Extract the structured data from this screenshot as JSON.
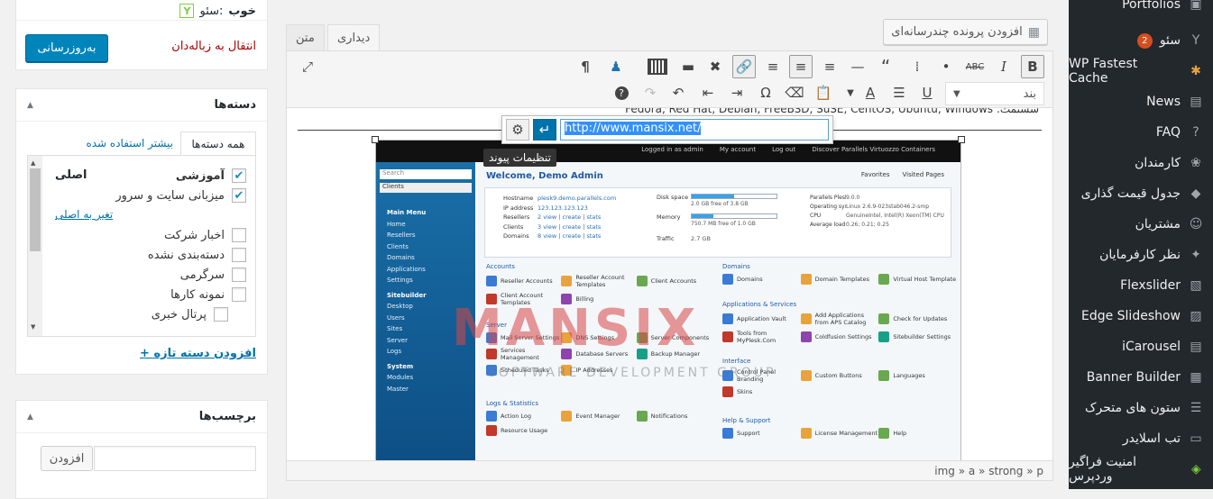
{
  "admin_menu": {
    "items": [
      {
        "label": "Portfolios",
        "icon": "portfolio-icon"
      },
      {
        "label": "سئو",
        "icon": "yoast-icon",
        "badge": "2"
      },
      {
        "label": "WP Fastest Cache",
        "icon": "cheetah-icon"
      },
      {
        "label": "News",
        "icon": "news-icon"
      },
      {
        "label": "FAQ",
        "icon": "question-icon"
      },
      {
        "label": "کارمندان",
        "icon": "paw-icon"
      },
      {
        "label": "جدول قیمت گذاری",
        "icon": "tag-icon"
      },
      {
        "label": "مشتریان",
        "icon": "users-icon"
      },
      {
        "label": "نظر کارفرمایان",
        "icon": "testimonial-icon"
      },
      {
        "label": "Flexslider",
        "icon": "slides-icon"
      },
      {
        "label": "Edge Slideshow",
        "icon": "slideshow-icon"
      },
      {
        "label": "iCarousel",
        "icon": "carousel-icon"
      },
      {
        "label": "Banner Builder",
        "icon": "banner-icon"
      },
      {
        "label": "ستون های متحرک",
        "icon": "columns-icon"
      },
      {
        "label": "تب اسلایدر",
        "icon": "tab-slider-icon"
      },
      {
        "label": "امنیت فراگیر وردپرس",
        "icon": "shield-icon"
      }
    ]
  },
  "editor": {
    "tabs": {
      "visual": "دیداری",
      "text": "متن"
    },
    "add_media": "افزودن پرونده چندرسانه‌ای",
    "format_select": "بند",
    "status_path": "img » a » strong » p",
    "content_line": "Fedora, Red Hat, Debian, FreeBSD, SuSE, CentOS, Ubuntu, Windows :ششتمت",
    "link_popup": {
      "url": "http://www.mansix.net/",
      "tooltip": "تنظیمات پیوند"
    }
  },
  "publish_box": {
    "seo_label": "سئو:",
    "seo_value": "خوب",
    "trash_link": "انتقال به زباله‌دان",
    "update_button": "به‌روزرسانی"
  },
  "categories_box": {
    "title": "دسته‌ها",
    "tab_all": "همه دسته‌ها",
    "tab_popular": "بیشتر استفاده شده",
    "items": [
      {
        "label": "آموزشی",
        "checked": true,
        "primary": "اصلی",
        "bold": true
      },
      {
        "label": "میزبانی سایت و سرور",
        "checked": true,
        "make_primary": "تغیر به اصلی"
      },
      {
        "label": "اخبار شرکت",
        "checked": false
      },
      {
        "label": "دسته‌بندی نشده",
        "checked": false
      },
      {
        "label": "سرگرمی",
        "checked": false
      },
      {
        "label": "نمونه کارها",
        "checked": false
      },
      {
        "label": "پرتال خبری",
        "checked": false
      }
    ],
    "add_new": "+ افزودن دسته تازه"
  },
  "tags_box": {
    "title": "برچسب‌ها",
    "add_button": "افزودن"
  },
  "embedded_screenshot": {
    "topbar": [
      "Logged in as admin",
      "My account",
      "Log out",
      "Discover Parallels Virtuozzo Containers"
    ],
    "search_placeholder": "Search",
    "search_scope": "Clients",
    "main_menu_title": "Main Menu",
    "main_menu": [
      "Home",
      "Resellers",
      "Clients",
      "Domains",
      "Applications",
      "Settings"
    ],
    "sitebuilder_title": "Sitebuilder",
    "sitebuilder_menu": [
      "Desktop",
      "Users",
      "Sites",
      "Server",
      "Logs"
    ],
    "system_title": "System",
    "system_menu": [
      "Modules",
      "Master"
    ],
    "welcome": "Welcome, Demo Admin",
    "favorites": "Favorites",
    "visited": "Visited Pages",
    "info_rows": [
      [
        "Hostname",
        "plesk9.demo.parallels.com"
      ],
      [
        "IP address",
        "123.123.123.123"
      ],
      [
        "Resellers",
        "2  view | create | stats"
      ],
      [
        "Clients",
        "3  view | create | stats"
      ],
      [
        "Domains",
        "8  view | create | stats"
      ]
    ],
    "disk_space": "Disk space",
    "disk_note": "2.0 GB free of 3.8 GB",
    "disk_fraction": 0.5,
    "memory": "Memory",
    "memory_note": "750.7 MB free of 1.0 GB",
    "memory_fraction": 0.25,
    "traffic": "Traffic",
    "traffic_value": "2.7 GB",
    "sys_rows": [
      [
        "Parallels Plesk Panel version",
        "9.0.0"
      ],
      [
        "Operating system",
        "Linux 2.6.9-023stab046.2-smp"
      ],
      [
        "CPU",
        "GenuineIntel, Intel(R) Xeon(TM) CPU 2.40GHz"
      ],
      [
        "Average load",
        "0.26; 0.21; 0.25"
      ]
    ],
    "sections": {
      "accounts": "Accounts",
      "domains": "Domains",
      "applications": "Applications & Services",
      "server": "Server",
      "interface": "Interface",
      "logs": "Logs & Statistics",
      "help": "Help & Support"
    },
    "accounts_items": [
      "Reseller Accounts",
      "Reseller Account Templates",
      "Client Accounts",
      "Client Account Templates",
      "Billing"
    ],
    "domains_items": [
      "Domains",
      "Domain Templates",
      "Virtual Host Template"
    ],
    "apps_items": [
      "Application Vault",
      "Add Applications from APS Catalog",
      "Check for Updates",
      "Tools from MyPlesk.Com",
      "Coldfusion Settings",
      "Sitebuilder Settings"
    ],
    "server_items": [
      "Mail Server Settings",
      "DNS Settings",
      "Server Components",
      "Services Management",
      "Database Servers",
      "Backup Manager",
      "Scheduled Tasks",
      "IP Addresses"
    ],
    "interface_items": [
      "Control Panel Branding",
      "Custom Buttons",
      "Languages",
      "Skins"
    ],
    "logs_items": [
      "Action Log",
      "Event Manager",
      "Notifications",
      "Resource Usage"
    ],
    "help_items": [
      "Support",
      "License Management",
      "Help"
    ],
    "watermark": "MANSIX",
    "watermark_sub": "SOFTWARE DEVELOPMENT GROUP"
  }
}
